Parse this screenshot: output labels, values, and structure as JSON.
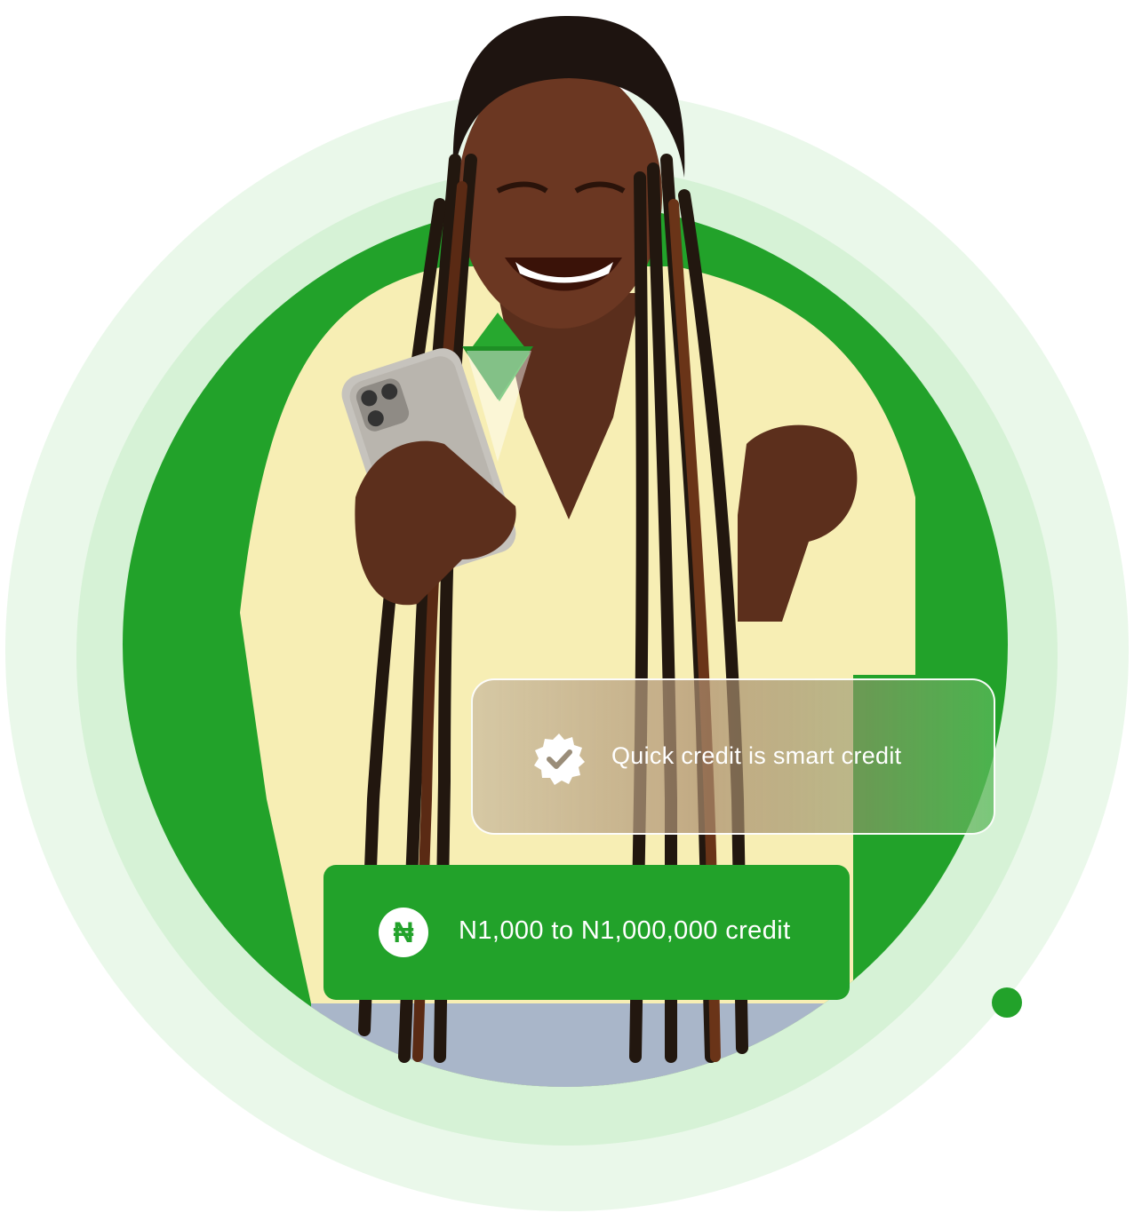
{
  "colors": {
    "brand_green": "#22a22a",
    "ring_outer": "#eaf8ea",
    "ring_mid": "#d6f2d6",
    "text_on_card": "#ffffff"
  },
  "badges": {
    "quick_credit": {
      "icon": "verified-badge-icon",
      "label": "Quick credit is smart credit"
    },
    "credit_range": {
      "icon": "naira-icon",
      "icon_glyph": "₦",
      "label": "N1,000 to N1,000,000 credit"
    }
  }
}
